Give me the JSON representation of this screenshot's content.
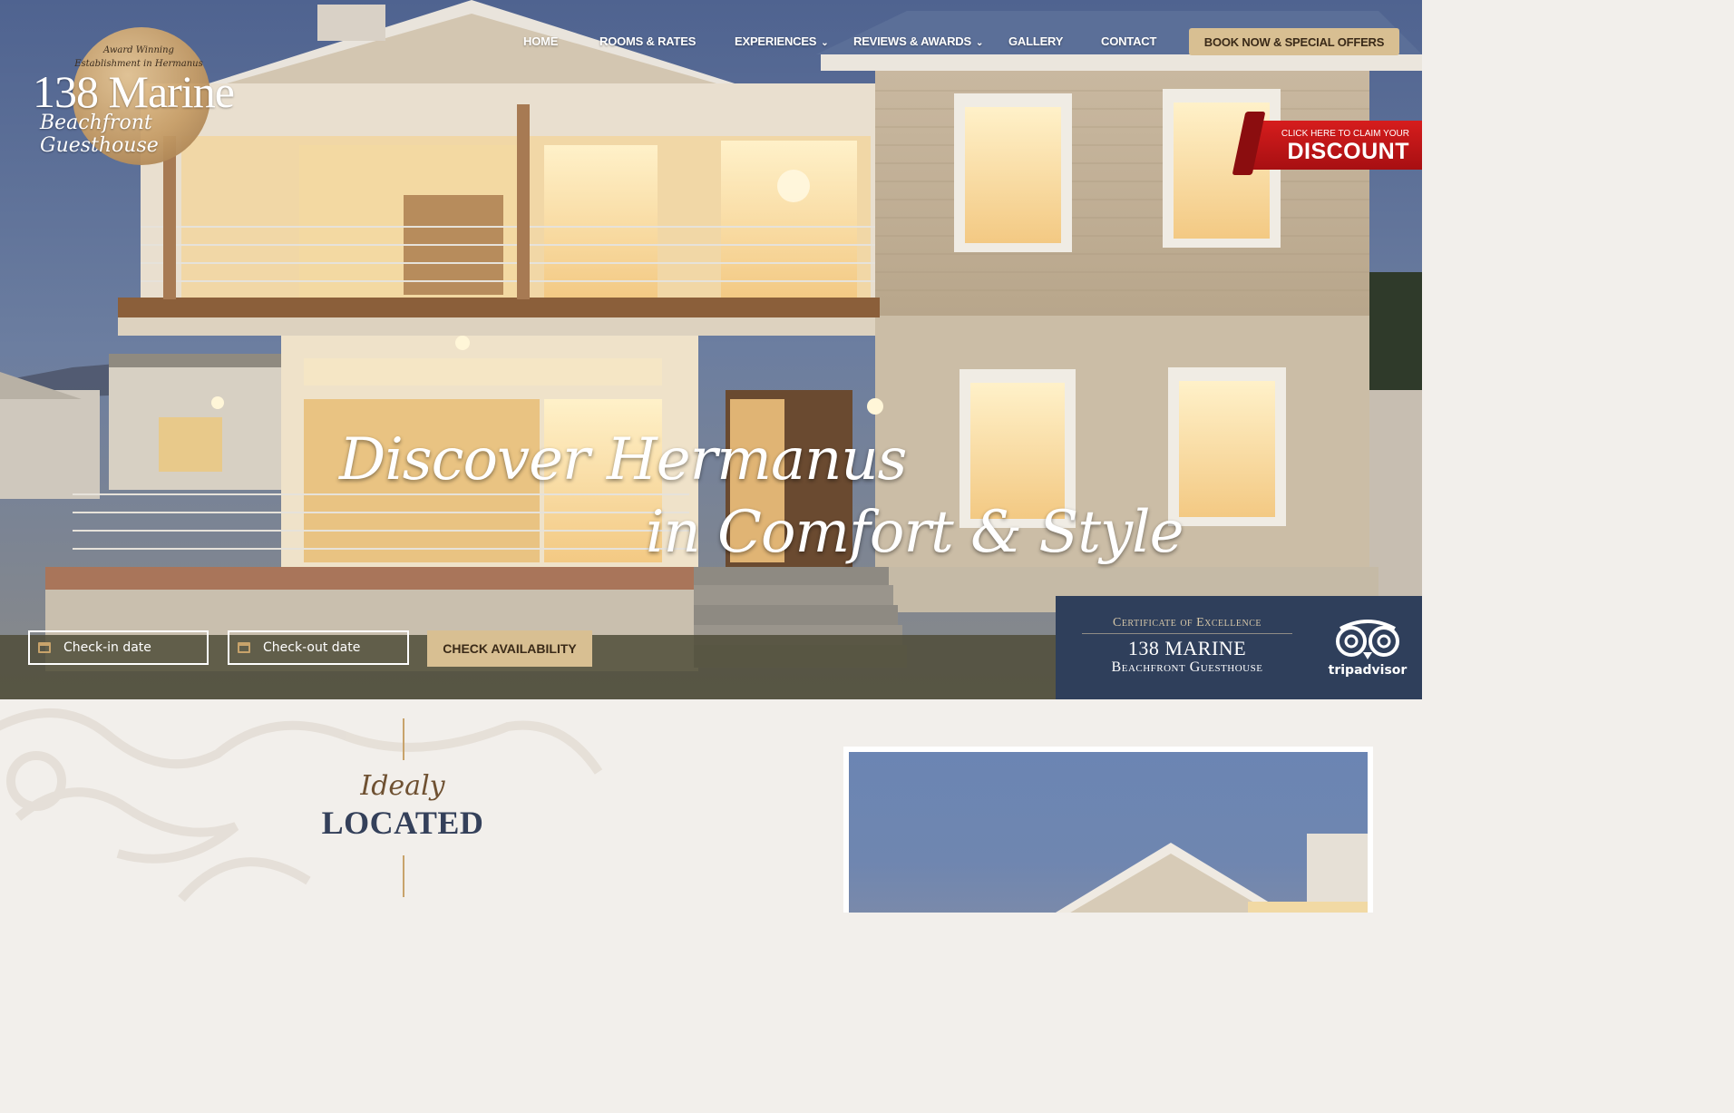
{
  "brand": {
    "tagline": "Award Winning Establishment in Hermanus",
    "name": "138 Marine",
    "subtitle": "Beachfront Guesthouse"
  },
  "nav": {
    "items": [
      {
        "label": "HOME"
      },
      {
        "label": "ROOMS & RATES"
      },
      {
        "label": "EXPERIENCES",
        "has_dropdown": true
      },
      {
        "label": "REVIEWS & AWARDS",
        "has_dropdown": true
      },
      {
        "label": "GALLERY"
      },
      {
        "label": "CONTACT"
      }
    ],
    "book_button": "BOOK NOW & SPECIAL OFFERS"
  },
  "promo": {
    "small": "CLICK HERE TO CLAIM YOUR",
    "big": "DISCOUNT"
  },
  "hero": {
    "line1": "Discover Hermanus",
    "line2": "in Comfort & Style"
  },
  "booking": {
    "checkin_placeholder": "Check-in date",
    "checkout_placeholder": "Check-out date",
    "check_button": "CHECK AVAILABILITY"
  },
  "certificate": {
    "title": "Certificate of Excellence",
    "name": "138 MARINE",
    "subtitle": "Beachfront Guesthouse",
    "provider": "tripadvisor"
  },
  "section": {
    "script": "Idealy",
    "title": "LOCATED"
  },
  "colors": {
    "accent_gold": "#d8bf92",
    "navy": "#2f3f5b",
    "promo_red": "#c4161b",
    "section_bg": "#f2efeb"
  }
}
